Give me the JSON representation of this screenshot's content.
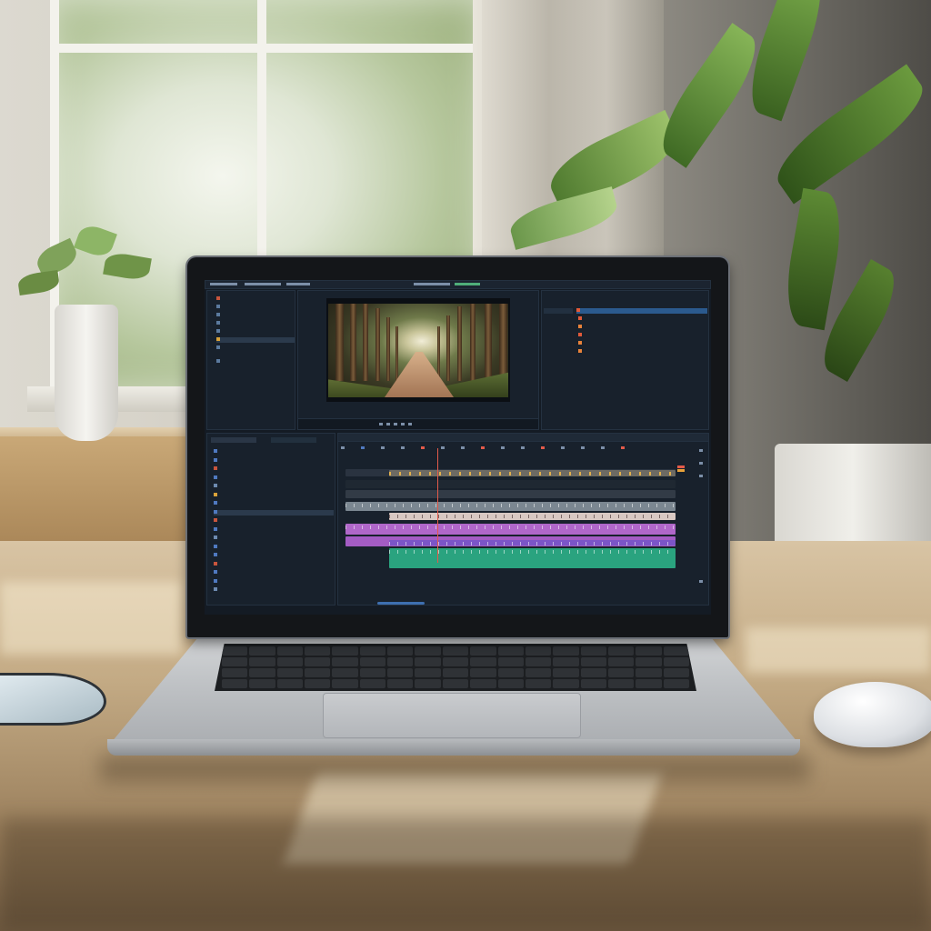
{
  "scene": {
    "subject": "laptop-video-editor",
    "colors": {
      "wall": "#d6d2c8",
      "desk": "#c4ab85",
      "ui_bg": "#141b24",
      "track_pink": "#b067c9",
      "track_green": "#2aa37f",
      "track_purple": "#7b55c8",
      "track_light": "#d9c9c3",
      "playhead": "#e35a4a",
      "selection": "#2b5a8e"
    }
  },
  "editor": {
    "icons": [
      "folder-icon",
      "film-icon",
      "music-icon",
      "play-icon",
      "scissors-icon",
      "settings-icon"
    ]
  }
}
